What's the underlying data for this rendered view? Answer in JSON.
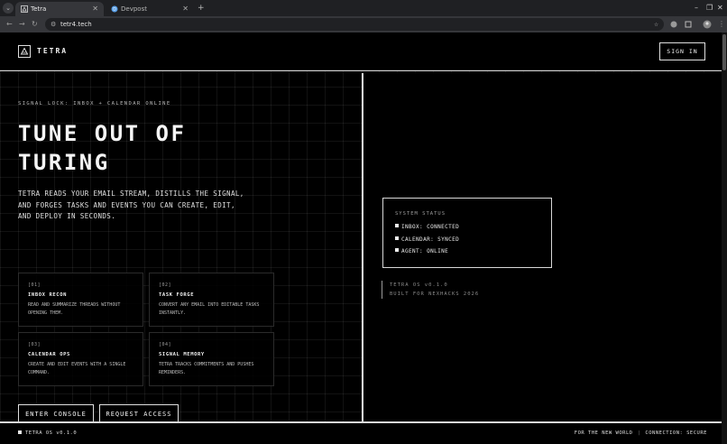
{
  "browser": {
    "tabs": [
      {
        "title": "Tetra",
        "active": true
      },
      {
        "title": "Devpost",
        "active": false
      }
    ],
    "url": "tetr4.tech"
  },
  "header": {
    "logo_text": "TETRA",
    "signin_label": "SIGN IN"
  },
  "hero": {
    "kicker": "SIGNAL LOCK: INBOX + CALENDAR ONLINE",
    "headline_line1": "TUNE OUT OF",
    "headline_line2": "TURING",
    "intro": "TETRA READS YOUR EMAIL STREAM, DISTILLS THE SIGNAL, AND FORGES TASKS AND EVENTS YOU CAN CREATE, EDIT, AND DEPLOY IN SECONDS."
  },
  "features": [
    {
      "num": "[01]",
      "title": "INBOX RECON",
      "desc": "READ AND SUMMARIZE THREADS WITHOUT OPENING THEM."
    },
    {
      "num": "[02]",
      "title": "TASK FORGE",
      "desc": "CONVERT ANY EMAIL INTO EDITABLE TASKS INSTANTLY."
    },
    {
      "num": "[03]",
      "title": "CALENDAR OPS",
      "desc": "CREATE AND EDIT EVENTS WITH A SINGLE COMMAND."
    },
    {
      "num": "[04]",
      "title": "SIGNAL MEMORY",
      "desc": "TETRA TRACKS COMMITMENTS AND PUSHES REMINDERS."
    }
  ],
  "cta": {
    "primary": "ENTER CONSOLE",
    "secondary": "REQUEST ACCESS"
  },
  "status": {
    "title": "SYSTEM STATUS",
    "items": [
      "INBOX: CONNECTED",
      "CALENDAR: SYNCED",
      "AGENT: ONLINE"
    ]
  },
  "os_info": {
    "version": "TETRA OS v0.1.0",
    "built_for": "BUILT FOR NEXHACKS 2026"
  },
  "footer": {
    "left": "TETRA OS v0.1.0",
    "right_1": "FOR THE NEW WORLD",
    "right_sep": "|",
    "right_2": "CONNECTION: SECURE"
  }
}
